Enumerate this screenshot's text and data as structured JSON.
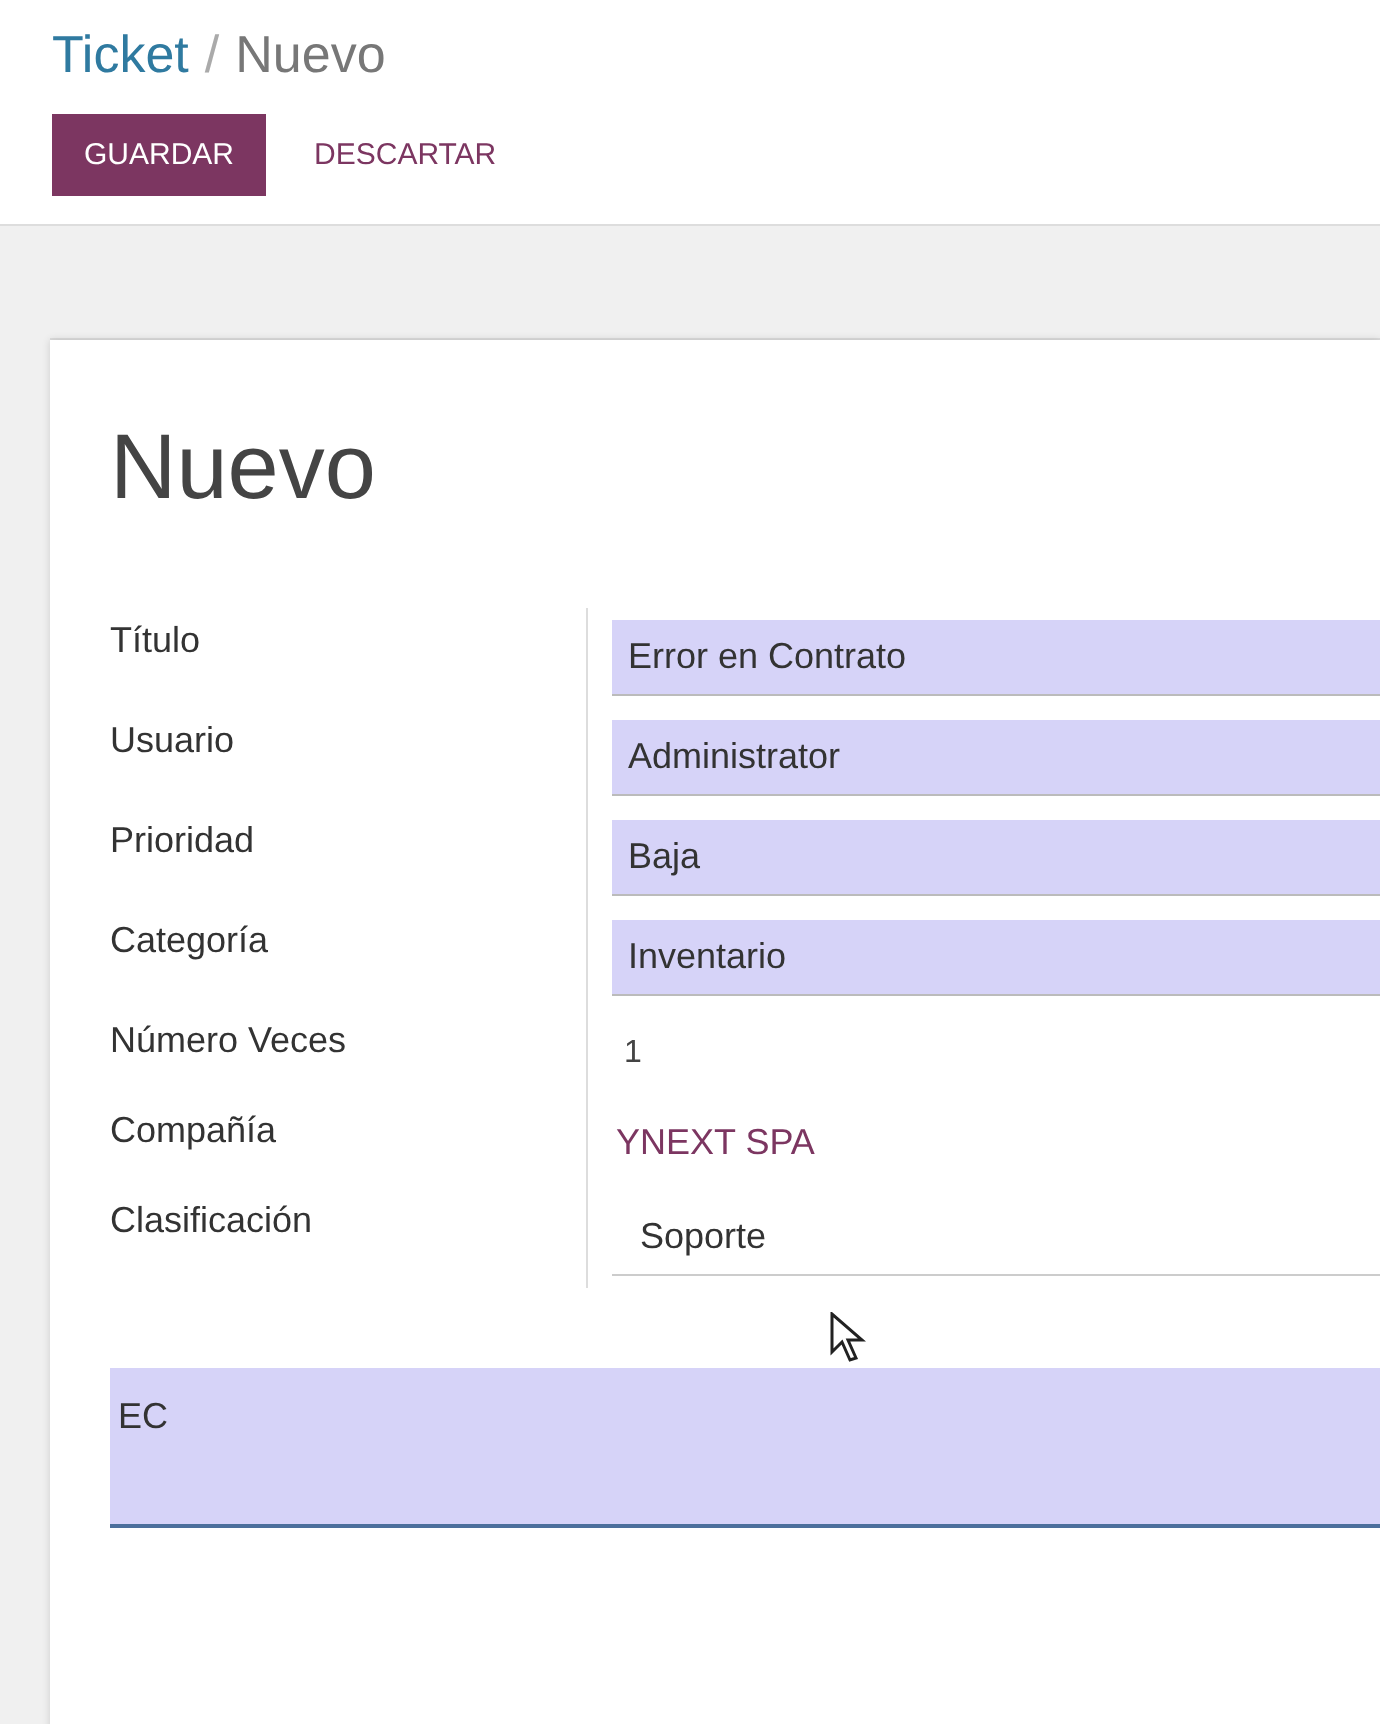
{
  "breadcrumb": {
    "parent": "Ticket",
    "separator": "/",
    "current": "Nuevo"
  },
  "buttons": [
    {
      "label": "GUARDAR",
      "kind": "primary"
    },
    {
      "label": "DESCARTAR",
      "kind": "secondary"
    }
  ],
  "form": {
    "title": "Nuevo",
    "fields": [
      {
        "label": "Título",
        "value": "Error en Contrato",
        "kind": "input"
      },
      {
        "label": "Usuario",
        "value": "Administrator",
        "kind": "input"
      },
      {
        "label": "Prioridad",
        "value": "Baja",
        "kind": "input"
      },
      {
        "label": "Categoría",
        "value": "Inventario",
        "kind": "input"
      },
      {
        "label": "Número Veces",
        "value": "1",
        "kind": "readonly"
      },
      {
        "label": "Compañía",
        "value": "YNEXT SPA",
        "kind": "link"
      },
      {
        "label": "Clasificación",
        "value": "Soporte",
        "kind": "select"
      }
    ],
    "description": {
      "value": "EC"
    }
  }
}
